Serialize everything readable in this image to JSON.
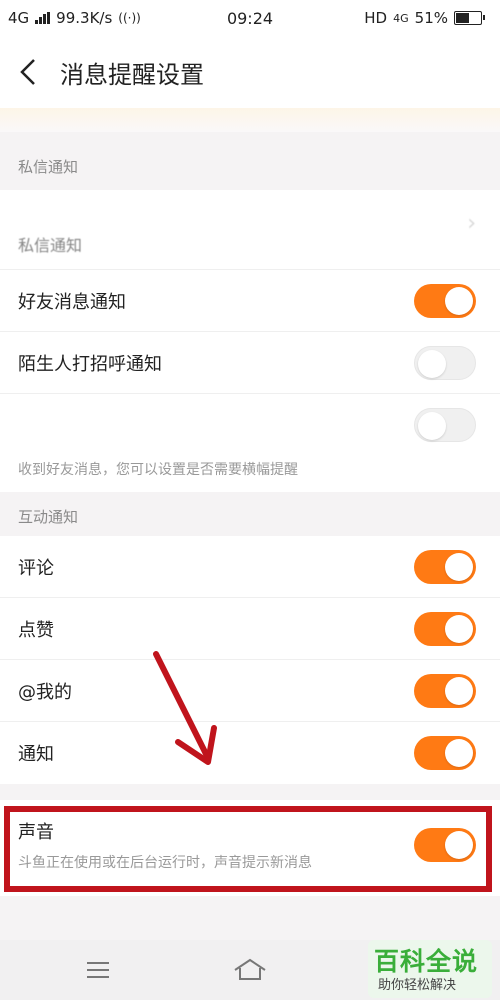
{
  "status_bar": {
    "network": "4G",
    "speed": "99.3K/s",
    "time": "09:24",
    "hd": "HD",
    "hd_net": "4G",
    "battery": "51%"
  },
  "header": {
    "back_icon": "chevron-left-icon",
    "title": "消息提醒设置"
  },
  "sections": {
    "private": {
      "header": "私信通知",
      "first_row_label": "私信通知",
      "rows": {
        "friend": {
          "label": "好友消息通知",
          "on": true
        },
        "stranger": {
          "label": "陌生人打招呼通知",
          "on": false
        },
        "third": {
          "on": false
        }
      },
      "hint": "收到好友消息，您可以设置是否需要横幅提醒"
    },
    "interaction": {
      "header": "互动通知",
      "rows": {
        "comment": {
          "label": "评论",
          "on": true
        },
        "like": {
          "label": "点赞",
          "on": true
        },
        "mention": {
          "label": "@我的",
          "on": true
        },
        "notice": {
          "label": "通知",
          "on": true
        }
      }
    },
    "sound": {
      "label": "声音",
      "description": "斗鱼正在使用或在后台运行时，声音提示新消息",
      "on": true
    }
  },
  "bottom_nav": {
    "icons": [
      "menu-icon",
      "home-icon"
    ]
  },
  "watermark": {
    "title": "百科全说",
    "subtitle": "助你轻松解决"
  },
  "colors": {
    "accent": "#ff7a14",
    "highlight_box": "#c0141c"
  }
}
